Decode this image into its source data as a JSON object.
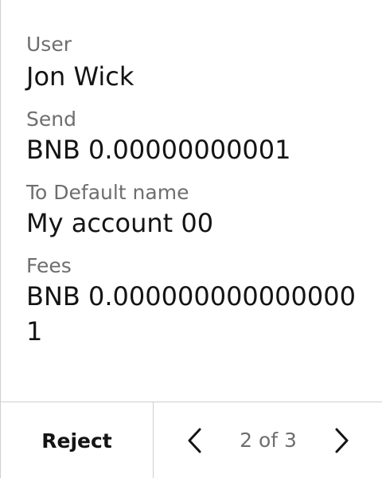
{
  "fields": {
    "user": {
      "label": "User",
      "value": "Jon Wick"
    },
    "send": {
      "label": "Send",
      "value": "BNB 0.00000000001"
    },
    "to": {
      "label": "To Default name",
      "value": "My account 00"
    },
    "fees": {
      "label": "Fees",
      "value": "BNB 0.0000000000000001"
    }
  },
  "footer": {
    "reject_label": "Reject",
    "prev_icon": "chevron-left-icon",
    "next_icon": "chevron-right-icon",
    "page_indicator": "2 of 3",
    "current_page": 2,
    "total_pages": 3
  }
}
